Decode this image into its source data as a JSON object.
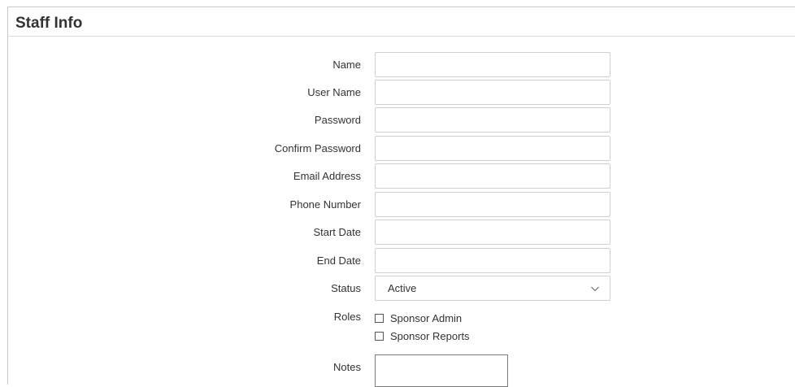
{
  "panel": {
    "title": "Staff Info"
  },
  "form": {
    "fields": [
      {
        "label": "Name",
        "value": ""
      },
      {
        "label": "User Name",
        "value": ""
      },
      {
        "label": "Password",
        "value": ""
      },
      {
        "label": "Confirm Password",
        "value": ""
      },
      {
        "label": "Email Address",
        "value": ""
      },
      {
        "label": "Phone Number",
        "value": ""
      },
      {
        "label": "Start Date",
        "value": ""
      },
      {
        "label": "End Date",
        "value": ""
      }
    ],
    "status": {
      "label": "Status",
      "value": "Active"
    },
    "roles": {
      "label": "Roles",
      "options": [
        {
          "label": "Sponsor Admin",
          "checked": false
        },
        {
          "label": "Sponsor Reports",
          "checked": false
        }
      ]
    },
    "notes": {
      "label": "Notes",
      "value": ""
    }
  },
  "icons": {
    "status_chevron": "chevron-down-icon"
  },
  "colors": {
    "border": "#cfcfcf",
    "text": "#333333",
    "background": "#ffffff"
  }
}
